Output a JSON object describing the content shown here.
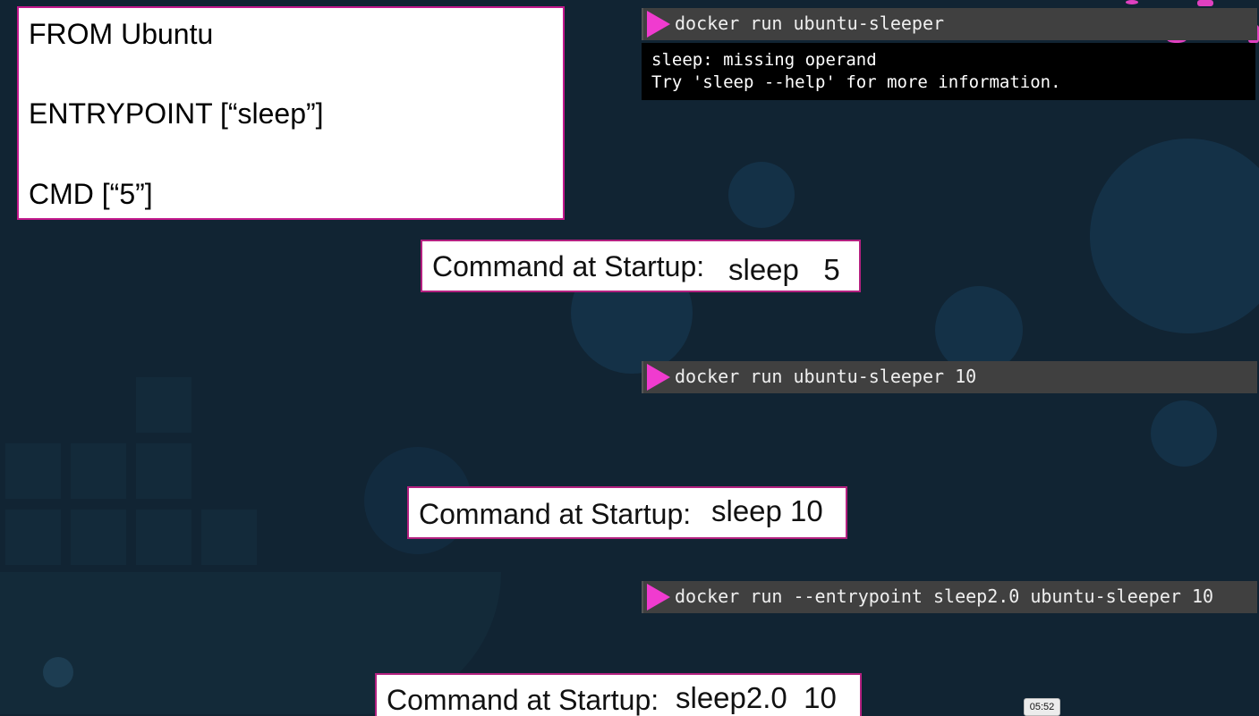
{
  "dockerfile": {
    "from": "FROM Ubuntu",
    "entrypoint": "ENTRYPOINT [“sleep”]",
    "cmd": "CMD [“5”]"
  },
  "terminals": [
    {
      "command": "docker run ubuntu-sleeper"
    },
    {
      "command": "docker run ubuntu-sleeper 10"
    },
    {
      "command": "docker run --entrypoint sleep2.0 ubuntu-sleeper 10"
    }
  ],
  "output": {
    "line1": "sleep: missing operand",
    "line2": "Try 'sleep --help' for more information."
  },
  "startup": [
    {
      "label": "Command at Startup:",
      "value": "sleep   5"
    },
    {
      "label": "Command at Startup:",
      "value": "sleep 10"
    },
    {
      "label": "Command at Startup:",
      "value": "sleep2.0  10"
    }
  ],
  "video": {
    "timestamp": "05:52"
  },
  "colors": {
    "accent": "#f03bcf",
    "background": "#112433",
    "terminal": "#404040"
  }
}
